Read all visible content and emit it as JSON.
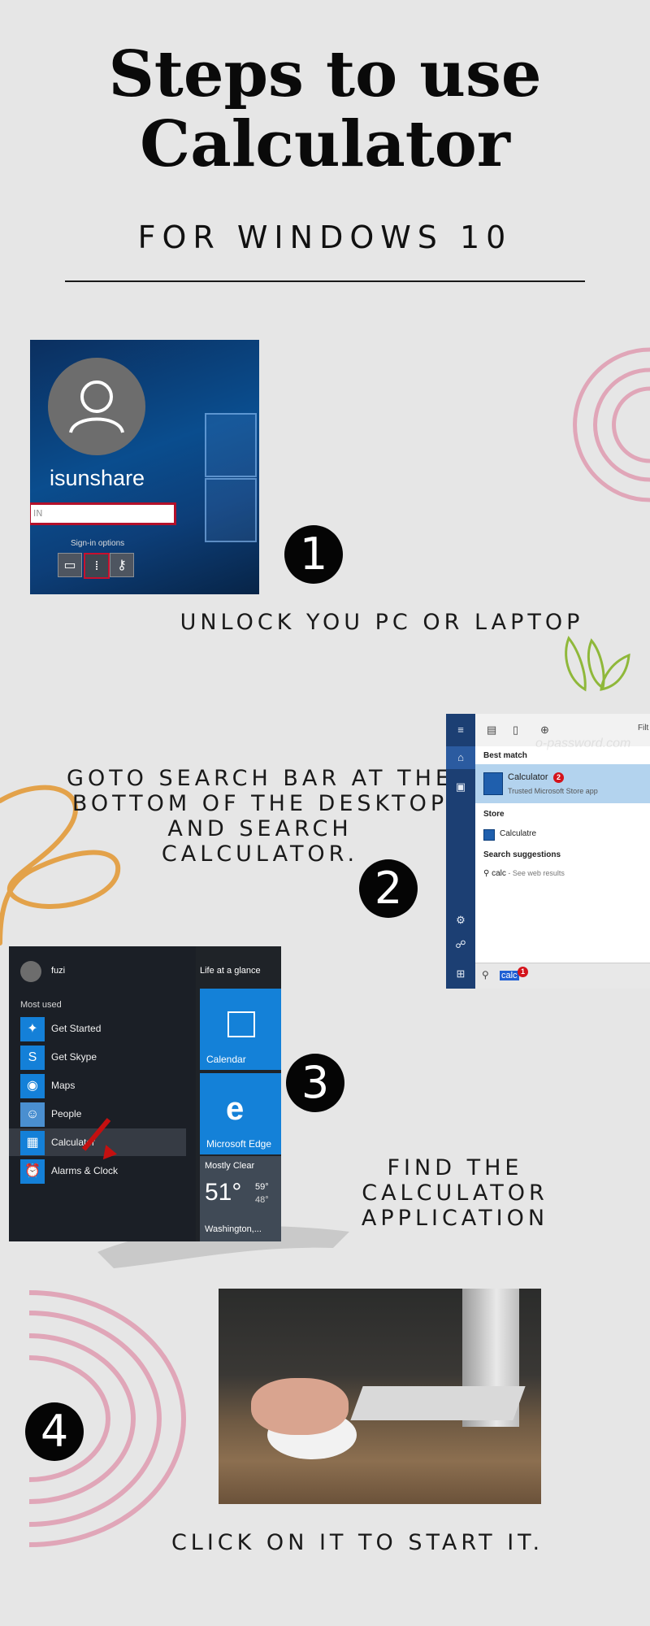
{
  "header": {
    "title_line1": "Steps to use",
    "title_line2": "Calculator",
    "subtitle": "FOR WINDOWS 10"
  },
  "steps": [
    {
      "number": "1",
      "caption": "UNLOCK YOU PC OR LAPTOP"
    },
    {
      "number": "2",
      "caption_lines": [
        "GOTO SEARCH BAR AT THE",
        "BOTTOM OF THE DESKTOP",
        "AND SEARCH CALCULATOR."
      ]
    },
    {
      "number": "3",
      "caption_lines": [
        "FIND THE CALCULATOR",
        "APPLICATION"
      ]
    },
    {
      "number": "4",
      "caption": "CLICK ON IT TO START IT."
    }
  ],
  "screen1": {
    "username": "isunshare",
    "pin_placeholder": "IN",
    "signin_label": "Sign-in options"
  },
  "screen2": {
    "filter_label": "Filt",
    "watermark": "o-password.com",
    "best_match_label": "Best match",
    "best_match_title": "Calculator",
    "best_match_badge": "2",
    "best_match_sub": "Trusted Microsoft Store app",
    "store_label": "Store",
    "store_item": "Calculatre",
    "suggestions_label": "Search suggestions",
    "suggestion_term": "calc",
    "suggestion_rest": " - See web results",
    "search_query": "calc",
    "search_badge": "1"
  },
  "screen3": {
    "user": "fuzi",
    "life_label": "Life at a glance",
    "most_used_label": "Most used",
    "apps": [
      "Get Started",
      "Get Skype",
      "Maps",
      "People",
      "Calculator",
      "Alarms & Clock"
    ],
    "tile_calendar": "Calendar",
    "tile_edge": "Microsoft Edge",
    "weather_cond": "Mostly Clear",
    "weather_temp": "51°",
    "weather_high": "59°",
    "weather_low": "48°",
    "weather_city": "Washington,..."
  },
  "colors": {
    "background": "#e6e6e6",
    "accent_pink": "#e0a6b8",
    "accent_orange": "#e3a24a",
    "accent_green": "#8fb83a"
  }
}
